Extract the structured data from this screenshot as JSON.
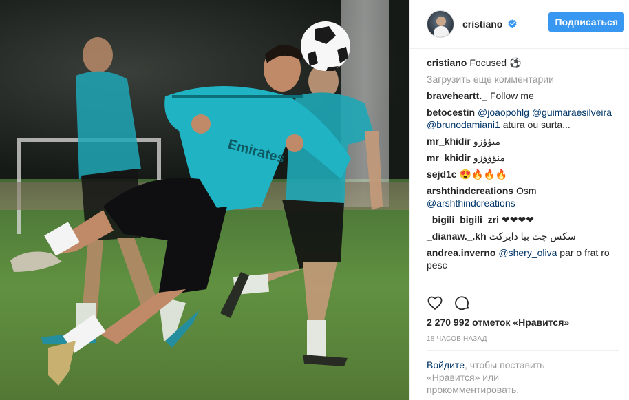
{
  "post": {
    "username": "cristiano",
    "follow_label": "Подписаться",
    "caption": "Focused ⚽",
    "load_more": "Загрузить еще комментарии",
    "comments": [
      {
        "user": "braveheartt._",
        "parts": [
          {
            "t": "text",
            "v": "Follow me"
          }
        ]
      },
      {
        "user": "betocestin",
        "parts": [
          {
            "t": "mention",
            "v": "@joaopohlg"
          },
          {
            "t": "text",
            "v": " "
          },
          {
            "t": "mention",
            "v": "@guimaraesilveira"
          },
          {
            "t": "text",
            "v": " "
          },
          {
            "t": "mention",
            "v": "@brunodamiani1"
          },
          {
            "t": "text",
            "v": " atura ou surta..."
          }
        ]
      },
      {
        "user": "mr_khidir",
        "parts": [
          {
            "t": "text",
            "v": "منؤؤزو"
          }
        ]
      },
      {
        "user": "mr_khidir",
        "parts": [
          {
            "t": "text",
            "v": "منؤؤؤزو"
          }
        ]
      },
      {
        "user": "sejd1c",
        "parts": [
          {
            "t": "text",
            "v": "😍🔥🔥🔥"
          }
        ]
      },
      {
        "user": "arshthindcreations",
        "parts": [
          {
            "t": "text",
            "v": "Osm "
          },
          {
            "t": "mention",
            "v": "@arshthindcreations"
          }
        ]
      },
      {
        "user": "_bigili_bigili_zri",
        "parts": [
          {
            "t": "text",
            "v": "❤❤❤❤"
          }
        ]
      },
      {
        "user": "_dianaw._.kh",
        "parts": [
          {
            "t": "text",
            "v": "سکس چت بیا دایرکت"
          }
        ]
      },
      {
        "user": "andrea.inverno",
        "parts": [
          {
            "t": "mention",
            "v": "@shery_oliva"
          },
          {
            "t": "text",
            "v": " par o frat ro pesc"
          }
        ]
      }
    ],
    "likes": "2 270 992 отметок «Нравится»",
    "time": "18 ЧАСОВ НАЗАД",
    "login_link": "Войдите",
    "login_text": ", чтобы поставить «Нравится» или прокомментировать."
  },
  "icons": {
    "verified": "verified-badge-icon",
    "like": "heart-icon",
    "comment": "comment-bubble-icon"
  },
  "colors": {
    "accent": "#3897f0",
    "mention": "#003569",
    "muted": "#999999"
  }
}
